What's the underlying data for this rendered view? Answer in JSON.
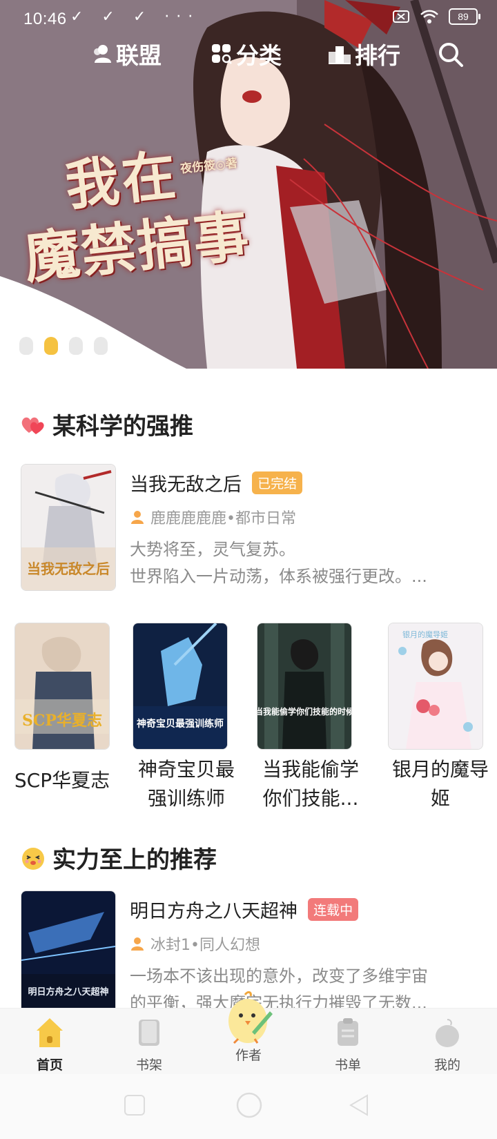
{
  "status_bar": {
    "time": "10:46",
    "notif_icons": "✓ ✓ ✓ ···",
    "battery": "89"
  },
  "top_nav": {
    "alliance": "联盟",
    "category": "分类",
    "ranking": "排行"
  },
  "banner": {
    "book_title_line1": "我在",
    "book_title_line2": "魔禁搞事",
    "author": "夜伤筱◎著",
    "active_dot": 1,
    "dot_count": 4
  },
  "section1": {
    "title": "某科学的强推",
    "feature": {
      "title": "当我无敌之后",
      "badge": "已完结",
      "meta": "鹿鹿鹿鹿鹿•都市日常",
      "desc_line1": "大势将至，灵气复苏。",
      "desc_line2": "世界陷入一片动荡，体系被强行更改。...",
      "cover_text": "当我无敌之后"
    },
    "grid": [
      {
        "title": "SCP华夏志",
        "cover_text": "SCP华夏志"
      },
      {
        "title_line1": "神奇宝贝最",
        "title_line2": "强训练师",
        "cover_text": "神奇宝贝最强训练师"
      },
      {
        "title_line1": "当我能偷学",
        "title_line2": "你们技能...",
        "cover_text": "当我能偷学你们技能的时候"
      },
      {
        "title_line1": "银月的魔导",
        "title_line2": "姬",
        "cover_text": "银月的魔导姬"
      }
    ]
  },
  "section2": {
    "title": "实力至上的推荐",
    "feature": {
      "title": "明日方舟之八天超神",
      "badge": "连载中",
      "meta": "冰封1•同人幻想",
      "desc_line1": "一场本不该出现的意外，改变了多维宇宙",
      "desc_line2": "的平衡，强大魔宗无执行力摧毁了无数...",
      "cover_text": "明日方舟之八天超神"
    }
  },
  "bottom_nav": {
    "home": "首页",
    "bookshelf": "书架",
    "author": "作者",
    "booklist": "书单",
    "mine": "我的"
  },
  "colors": {
    "accent_yellow": "#f5c241",
    "badge_done": "#f6b24c",
    "badge_serial": "#f27a7a"
  }
}
